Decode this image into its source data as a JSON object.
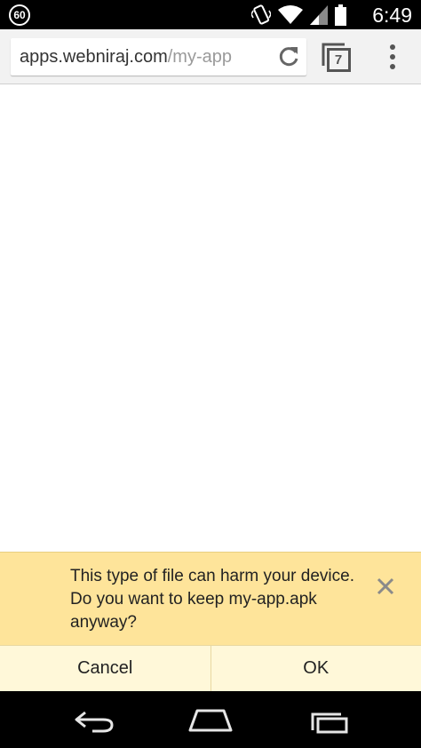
{
  "status_bar": {
    "notification_count": "60",
    "time": "6:49",
    "icons": [
      "vibrate-icon",
      "wifi-icon",
      "cell-signal-icon",
      "battery-icon"
    ]
  },
  "toolbar": {
    "url_host": "apps.webniraj.com",
    "url_path": "/my-app",
    "tab_count": "7",
    "icons": [
      "reload-icon",
      "tab-switcher-icon",
      "overflow-menu-icon"
    ]
  },
  "infobar": {
    "message": "This type of file can harm your device. Do you want to keep my-app.apk anyway?",
    "cancel_label": "Cancel",
    "ok_label": "OK",
    "background_color": "#fee49a",
    "button_row_color": "#fff8d9",
    "icons": [
      "close-icon"
    ]
  },
  "nav_bar": {
    "icons": [
      "back-icon",
      "home-icon",
      "recents-icon"
    ]
  }
}
